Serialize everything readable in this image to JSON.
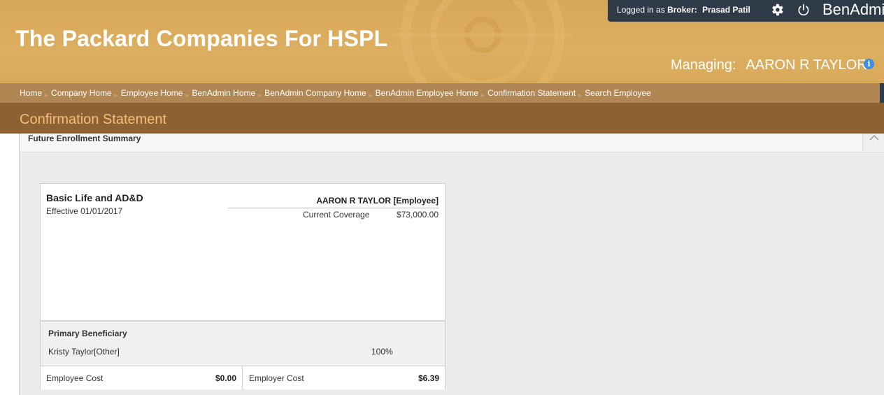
{
  "header": {
    "company_title": "The Packard Companies For HSPL",
    "login_prefix": "Logged in as",
    "login_role": "Broker:",
    "login_user": "Prasad Patil",
    "brand": "BenAdmi",
    "managing_label": "Managing:",
    "managing_name": "AARON R TAYLOR",
    "info_glyph": "i"
  },
  "breadcrumb": [
    "Home",
    "Company Home",
    "Employee Home",
    "BenAdmin Home",
    "BenAdmin Company Home",
    "BenAdmin Employee Home",
    "Confirmation Statement",
    "Search Employee"
  ],
  "breadcrumb_separator": "»",
  "page": {
    "title": "Confirmation Statement",
    "panel_title": "Future Enrollment Summary"
  },
  "plan_card": {
    "plan_name": "Basic Life and AD&D",
    "effective": "Effective 01/01/2017",
    "member_name": "AARON R TAYLOR [Employee]",
    "coverage_label": "Current Coverage",
    "coverage_value": "$73,000.00",
    "beneficiary_title": "Primary Beneficiary",
    "beneficiary_name": "Kristy Taylor[Other]",
    "beneficiary_pct": "100%",
    "employee_cost_label": "Employee Cost",
    "employee_cost_value": "$0.00",
    "employer_cost_label": "Employer Cost",
    "employer_cost_value": "$6.39"
  },
  "colors": {
    "header_gold": "#d8a857",
    "breadcrumb_bar": "#b08752",
    "section_bar": "#8f6132",
    "section_title": "#f0c07a",
    "topbar": "#2f3a48",
    "info_blue": "#3d8fe0"
  },
  "icons": {
    "settings": "gear-icon",
    "logout": "power-icon",
    "info": "info-icon",
    "collapse": "chevron-up-icon"
  }
}
